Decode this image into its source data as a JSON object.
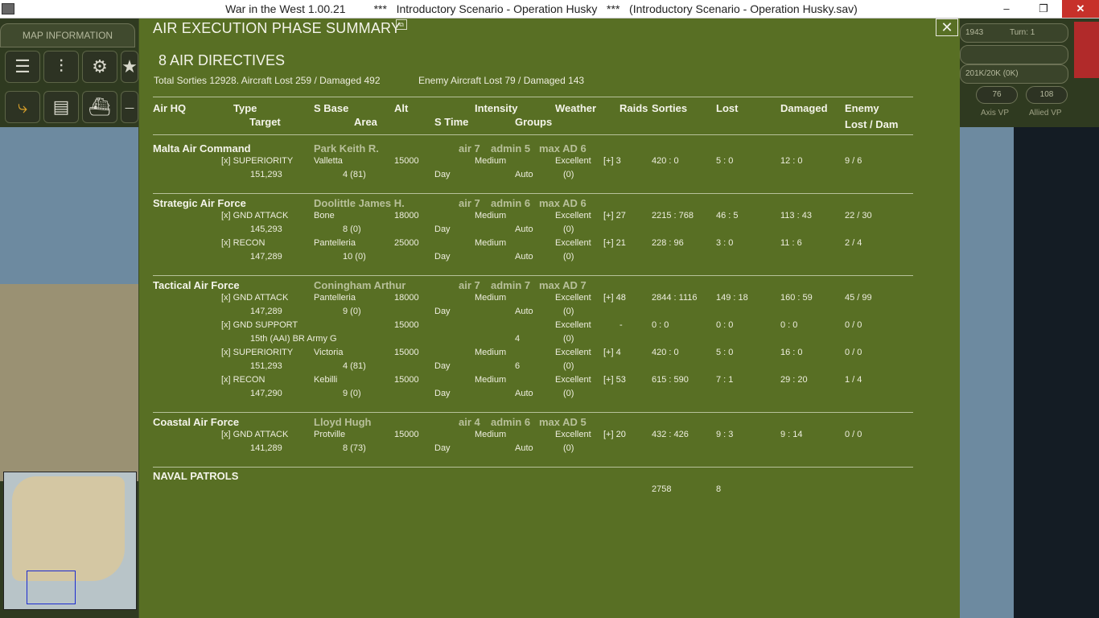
{
  "window": {
    "title": "War in the West 1.00.21         ***   Introductory Scenario - Operation Husky   ***   (Introductory Scenario - Operation Husky.sav)",
    "min": "–",
    "max": "❐",
    "close": "✕"
  },
  "left_panel": {
    "map_info_label": "MAP INFORMATION",
    "tools": [
      "☰",
      "⫶",
      "⚙",
      "★",
      "⤷",
      "▤",
      "⛴",
      "⎯"
    ]
  },
  "right_panel": {
    "date": "1943",
    "turn": "Turn: 1",
    "supply": "201K/20K (0K)",
    "axis_vp": "76",
    "axis_vp_label": "Axis VP",
    "allied_vp": "108",
    "allied_vp_label": "Allied VP"
  },
  "dialog": {
    "title": "AIR EXECUTION PHASE SUMMARY",
    "title_icon": "⧉",
    "close_icon": "✕",
    "directives": "8 AIR DIRECTIVES",
    "totals": "Total Sorties 12928.  Aircraft Lost 259 / Damaged 492",
    "enemy_totals": "Enemy Aircraft Lost 79 / Damaged 143",
    "headers": {
      "air_hq": "Air HQ",
      "type": "Type",
      "target": "Target",
      "s_base": "S Base",
      "area": "Area",
      "alt": "Alt",
      "s_time": "S Time",
      "intensity": "Intensity",
      "groups": "Groups",
      "weather": "Weather",
      "raids": "Raids",
      "sorties": "Sorties",
      "lost": "Lost",
      "damaged": "Damaged",
      "enemy": "Enemy",
      "enemy_lost_dam": "Lost / Dam"
    },
    "groups": [
      {
        "name": "Malta Air Command",
        "commander": "Park Keith R.",
        "air": "air 7",
        "admin": "admin 5",
        "max_ad": "max AD 6",
        "rows": [
          {
            "type": "[x]  SUPERIORITY",
            "target": "151,293",
            "base": "Valletta",
            "area": "4 (81)",
            "alt": "15000",
            "stime": "Day",
            "intensity": "Medium",
            "groups": "Auto",
            "weather": "Excellent",
            "weather2": "(0)",
            "raids": "[+] 3",
            "sorties": "420 : 0",
            "lost": "5 : 0",
            "damaged": "12 : 0",
            "enemy": "9 / 6"
          }
        ]
      },
      {
        "name": "Strategic Air Force",
        "commander": "Doolittle James H.",
        "air": "air 7",
        "admin": "admin 6",
        "max_ad": "max AD 6",
        "rows": [
          {
            "type": "[x]  GND ATTACK",
            "target": "145,293",
            "base": "Bone",
            "area": "8 (0)",
            "alt": "18000",
            "stime": "Day",
            "intensity": "Medium",
            "groups": "Auto",
            "weather": "Excellent",
            "weather2": "(0)",
            "raids": "[+] 27",
            "sorties": "2215 : 768",
            "lost": "46 : 5",
            "damaged": "113 : 43",
            "enemy": "22 / 30"
          },
          {
            "type": "[x]  RECON",
            "target": "147,289",
            "base": "Pantelleria",
            "area": "10 (0)",
            "alt": "25000",
            "stime": "Day",
            "intensity": "Medium",
            "groups": "Auto",
            "weather": "Excellent",
            "weather2": "(0)",
            "raids": "[+] 21",
            "sorties": "228 : 96",
            "lost": "3 : 0",
            "damaged": "11 : 6",
            "enemy": "2 / 4"
          }
        ]
      },
      {
        "name": "Tactical Air Force",
        "commander": "Coningham Arthur",
        "air": "air 7",
        "admin": "admin 7",
        "max_ad": "max AD 7",
        "rows": [
          {
            "type": "[x]  GND ATTACK",
            "target": "147,289",
            "base": "Pantelleria",
            "area": "9 (0)",
            "alt": "18000",
            "stime": "Day",
            "intensity": "Medium",
            "groups": "Auto",
            "weather": "Excellent",
            "weather2": "(0)",
            "raids": "[+] 48",
            "sorties": "2844 : 1116",
            "lost": "149 : 18",
            "damaged": "160 : 59",
            "enemy": "45 / 99"
          },
          {
            "type": "[x]  GND SUPPORT",
            "target": "15th (AAI) BR Army G",
            "base": "",
            "area": "",
            "alt": "15000",
            "stime": "",
            "intensity": "",
            "groups": "4",
            "weather": "Excellent",
            "weather2": "(0)",
            "raids": "-",
            "sorties": "0 : 0",
            "lost": "0 : 0",
            "damaged": "0 : 0",
            "enemy": "0 / 0"
          },
          {
            "type": "[x]  SUPERIORITY",
            "target": "151,293",
            "base": "Victoria",
            "area": "4 (81)",
            "alt": "15000",
            "stime": "Day",
            "intensity": "Medium",
            "groups": "6",
            "weather": "Excellent",
            "weather2": "(0)",
            "raids": "[+] 4",
            "sorties": "420 : 0",
            "lost": "5 : 0",
            "damaged": "16 : 0",
            "enemy": "0 / 0"
          },
          {
            "type": "[x]  RECON",
            "target": "147,290",
            "base": "Kebilli",
            "area": "9 (0)",
            "alt": "15000",
            "stime": "Day",
            "intensity": "Medium",
            "groups": "Auto",
            "weather": "Excellent",
            "weather2": "(0)",
            "raids": "[+] 53",
            "sorties": "615 : 590",
            "lost": "7 : 1",
            "damaged": "29 : 20",
            "enemy": "1 / 4"
          }
        ]
      },
      {
        "name": "Coastal Air Force",
        "commander": "Lloyd Hugh",
        "air": "air 4",
        "admin": "admin 6",
        "max_ad": "max AD 5",
        "rows": [
          {
            "type": "[x]  GND ATTACK",
            "target": "141,289",
            "base": "Protville",
            "area": "8 (73)",
            "alt": "15000",
            "stime": "Day",
            "intensity": "Medium",
            "groups": "Auto",
            "weather": "Excellent",
            "weather2": "(0)",
            "raids": "[+] 20",
            "sorties": "432 : 426",
            "lost": "9 : 3",
            "damaged": "9 : 14",
            "enemy": "0 / 0"
          }
        ]
      }
    ],
    "naval": {
      "title": "NAVAL PATROLS",
      "sorties": "2758",
      "lost": "8"
    }
  }
}
